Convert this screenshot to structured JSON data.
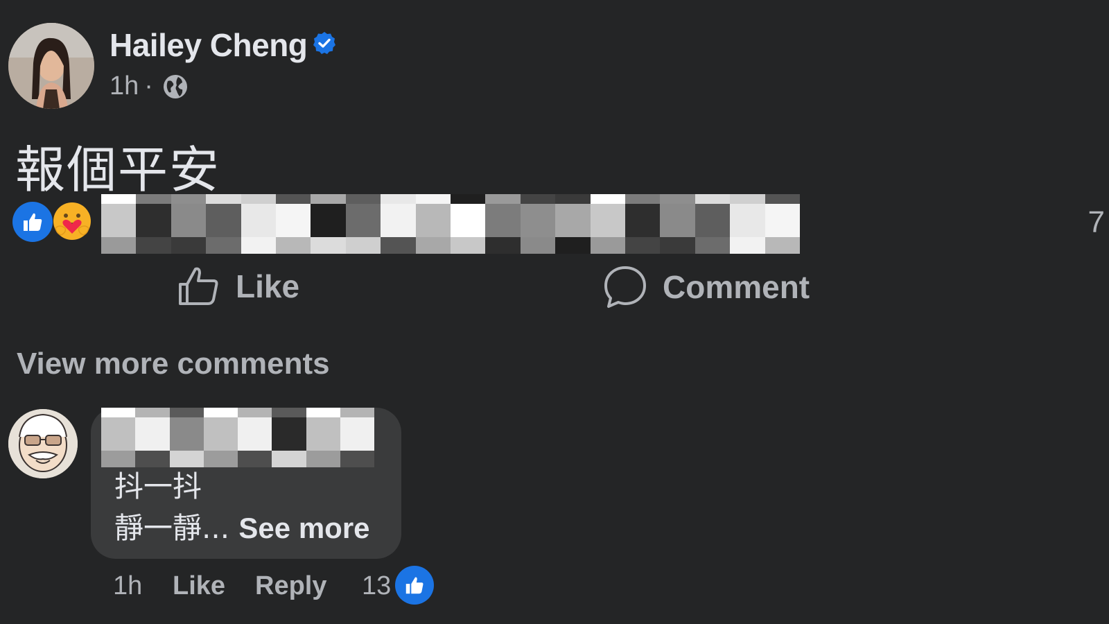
{
  "post": {
    "author_name": "Hailey Cheng",
    "time": "1h",
    "separator": "·",
    "text": "報個平安",
    "reaction_count": "7",
    "actions": {
      "like_label": "Like",
      "comment_label": "Comment"
    },
    "view_more_comments": "View more comments"
  },
  "comment": {
    "line1": "抖一抖",
    "line2": "靜一靜...",
    "see_more": "See more",
    "time": "1h",
    "like_label": "Like",
    "reply_label": "Reply",
    "like_count": "13"
  },
  "colors": {
    "background": "#242526",
    "bubble": "#3a3b3c",
    "primary_text": "#e4e6eb",
    "secondary_text": "#b0b3b8",
    "accent_blue": "#1b74e4"
  },
  "icons": {
    "verified": "verified-badge-icon",
    "audience": "globe-icon",
    "like": "thumbs-up-icon",
    "care": "care-reaction-icon",
    "comment": "speech-bubble-icon"
  }
}
